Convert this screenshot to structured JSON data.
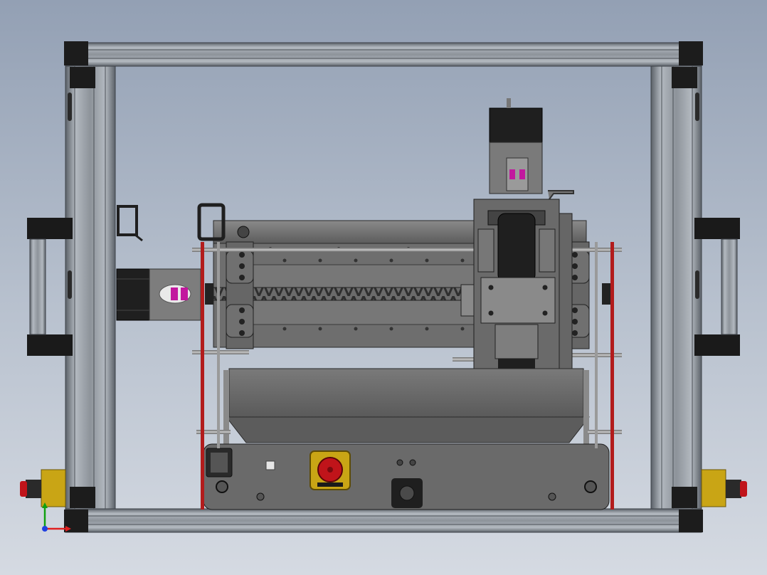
{
  "view": {
    "type": "cad-front-view",
    "subject": "desktop-cnc-gantry-assembly",
    "background_top": "#93a0b4",
    "background_bottom": "#d5dae2",
    "shading": "shaded-with-edges"
  },
  "colors": {
    "frame_extrusion": "#9aa1aa",
    "frame_dark": "#555b62",
    "corner_bracket": "#1c1c1c",
    "steel": "#6f6f6f",
    "dark_steel": "#3a3a3a",
    "motor_black": "#1f1f1f",
    "guard_red": "#b21c1c",
    "estop_yellow": "#c9a515",
    "estop_red": "#c0141a",
    "coupling_magenta": "#c2189e",
    "axis_x": "#e02020",
    "axis_y": "#10a010",
    "axis_z": "#2040e0"
  },
  "components": [
    "aluminium-extrusion-frame",
    "side-handles",
    "x-axis-stepper-motor",
    "x-axis-ballscrew",
    "linear-rails",
    "z-axis-carriage",
    "z-axis-stepper-motor",
    "spindle-holder",
    "work-table",
    "control-box",
    "emergency-stop-button",
    "side-emergency-stops",
    "red-guard-rods"
  ],
  "triad": {
    "axes": [
      "x",
      "y",
      "z"
    ]
  }
}
